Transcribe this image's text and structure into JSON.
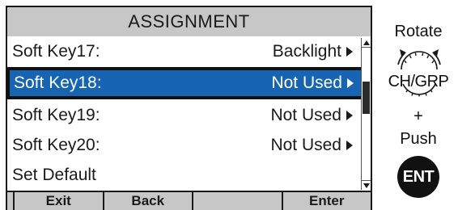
{
  "screen": {
    "title": "ASSIGNMENT",
    "items": [
      {
        "label": "Soft Key17:",
        "value": "Backlight"
      },
      {
        "label": "Soft Key18:",
        "value": "Not Used"
      },
      {
        "label": "Soft Key19:",
        "value": "Not Used"
      },
      {
        "label": "Soft Key20:",
        "value": "Not Used"
      },
      {
        "label": "Set Default",
        "value": ""
      }
    ],
    "selected_index": 1,
    "softkeys": [
      "Exit",
      "Back",
      "",
      "Enter"
    ]
  },
  "instructions": {
    "rotate": "Rotate",
    "knob": "CH/GRP",
    "plus": "+",
    "push": "Push",
    "button": "ENT"
  },
  "colors": {
    "selection": "#1764b3",
    "title_bar": "#c7c7c7",
    "softkey_bar": "#c7c7c7"
  }
}
